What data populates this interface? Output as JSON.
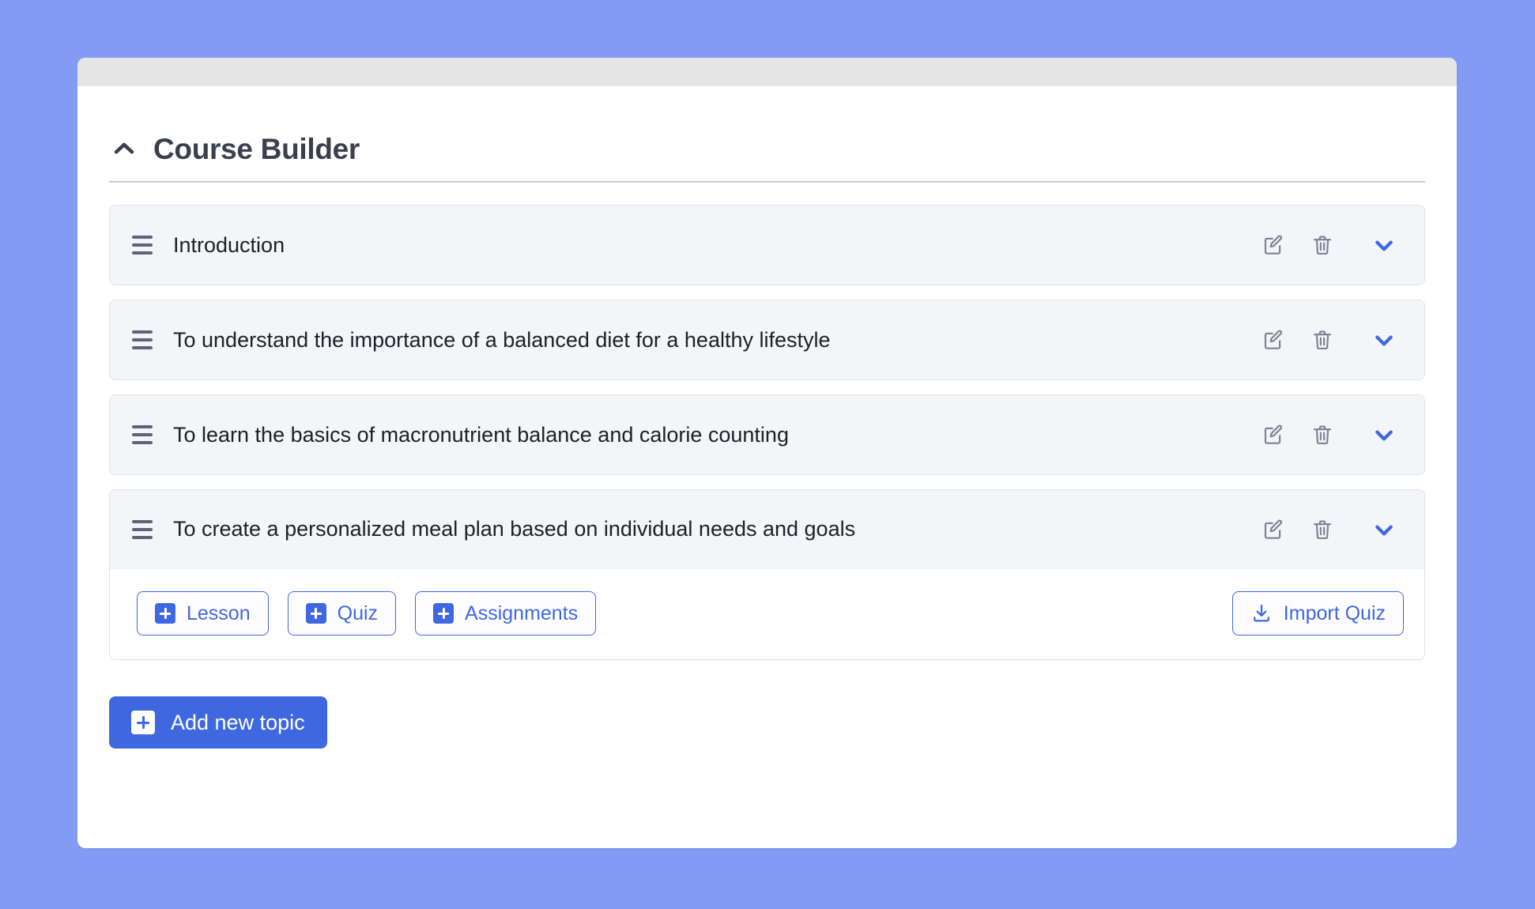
{
  "theme": {
    "page_background": "#849bf5",
    "card_background": "#ffffff",
    "accent_blue": "#3f68e0",
    "row_background": "#f4f5f8",
    "title_color": "#3b3f4d",
    "icon_gray": "#7b8194",
    "divider_color": "#c5cad1",
    "topstrip_color": "#e5e5e5"
  },
  "header": {
    "title": "Course Builder",
    "collapse_icon": "chevron-up-icon"
  },
  "topics": [
    {
      "title": "Introduction",
      "drag_icon": "drag-handle-icon",
      "edit_icon": "edit-icon",
      "delete_icon": "trash-icon",
      "toggle_icon": "chevron-down-icon",
      "expanded": false
    },
    {
      "title": "To understand the importance of a balanced diet for a healthy lifestyle",
      "drag_icon": "drag-handle-icon",
      "edit_icon": "edit-icon",
      "delete_icon": "trash-icon",
      "toggle_icon": "chevron-down-icon",
      "expanded": false
    },
    {
      "title": "To learn the basics of macronutrient balance and calorie counting",
      "drag_icon": "drag-handle-icon",
      "edit_icon": "edit-icon",
      "delete_icon": "trash-icon",
      "toggle_icon": "chevron-down-icon",
      "expanded": false
    },
    {
      "title": "To create a personalized meal plan based on individual needs and goals",
      "drag_icon": "drag-handle-icon",
      "edit_icon": "edit-icon",
      "delete_icon": "trash-icon",
      "toggle_icon": "chevron-down-icon",
      "expanded": true
    }
  ],
  "expanded_actions": {
    "lesson_label": "Lesson",
    "quiz_label": "Quiz",
    "assignments_label": "Assignments",
    "import_quiz_label": "Import Quiz",
    "import_icon": "download-icon"
  },
  "footer": {
    "add_topic_label": "Add new topic",
    "add_topic_icon": "plus-square-icon"
  }
}
